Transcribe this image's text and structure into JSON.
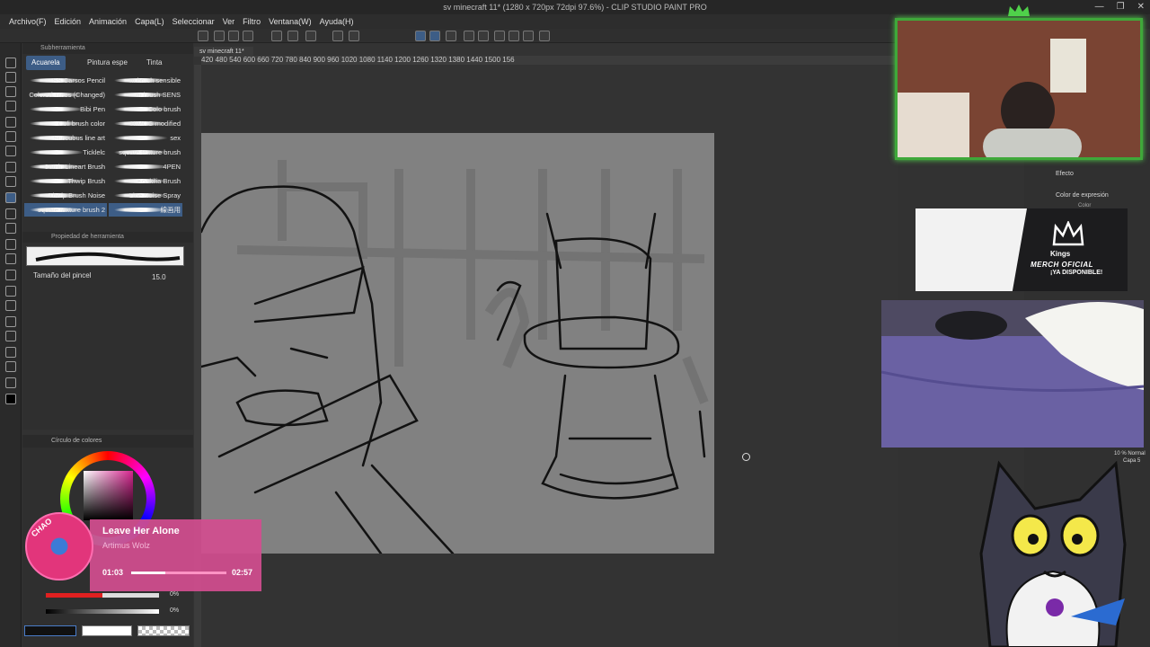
{
  "window": {
    "title": "sv minecraft 11* (1280 x 720px 72dpi 97.6%) - CLIP STUDIO PAINT PRO",
    "controls": [
      "—",
      "❐",
      "✕"
    ]
  },
  "menu": [
    "Archivo(F)",
    "Edición",
    "Animación",
    "Capa(L)",
    "Seleccionar",
    "Ver",
    "Filtro",
    "Ventana(W)",
    "Ayuda(H)"
  ],
  "subtool": {
    "panel_title": "Subherramienta",
    "tabs": [
      "Acuarela",
      "Pintura espe",
      "Tinta"
    ],
    "active_tab": "Acuarela",
    "brushes_left": [
      "SS Carsos Pencil",
      "Colored Trees (Changed)",
      "Bibi Pen",
      "Coli brush color",
      "Succubus line art",
      "Ticklelc",
      "Comic Lineart Brush",
      "Thwip Brush",
      "Thwip Brush Noise",
      "square texture brush 2"
    ],
    "brushes_right": [
      "m brush sensible",
      "m brush SENS",
      "Colo brush",
      "HIMOG modified",
      "sex",
      "square texture brush",
      "4PEN",
      "Koakilia Brush",
      "Line Noise Spray",
      "線画用"
    ]
  },
  "toolprop": {
    "panel_title": "Propiedad de herramienta",
    "size_label": "Tamaño del pincel",
    "size_value": "15.0"
  },
  "colorpanel": {
    "panel_title": "Círculo de colores",
    "selected_color": "#d6258f",
    "percent_s": "0%",
    "percent_v": "0%"
  },
  "canvas": {
    "tab_label": "sv minecraft 11*",
    "ruler_ticks": "420   480   540   600   660   720   780   840   900   960   1020   1080   1140   1200   1260   1320   1380   1440   1500   156",
    "paper_color": "#818181"
  },
  "rightdock": {
    "effect_label": "Efecto",
    "expression_label": "Color de expresión",
    "expression_value": "Color",
    "layer_label": "10 % Normal",
    "layer_sub": "Capa 5"
  },
  "overlays": {
    "merch_brand": "Kings",
    "merch_line1": "MERCH OFICIAL",
    "merch_line2": "¡YA DISPONIBLE!"
  },
  "nowplaying": {
    "label": "CHAO",
    "title": "Leave Her Alone",
    "artist": "Artimus Wolz",
    "elapsed": "01:03",
    "total": "02:57",
    "progress": 0.36
  },
  "colors": {
    "accent": "#3d5d86",
    "webcam_border": "#3fa83a",
    "widget_pink": "#d24e8f"
  }
}
